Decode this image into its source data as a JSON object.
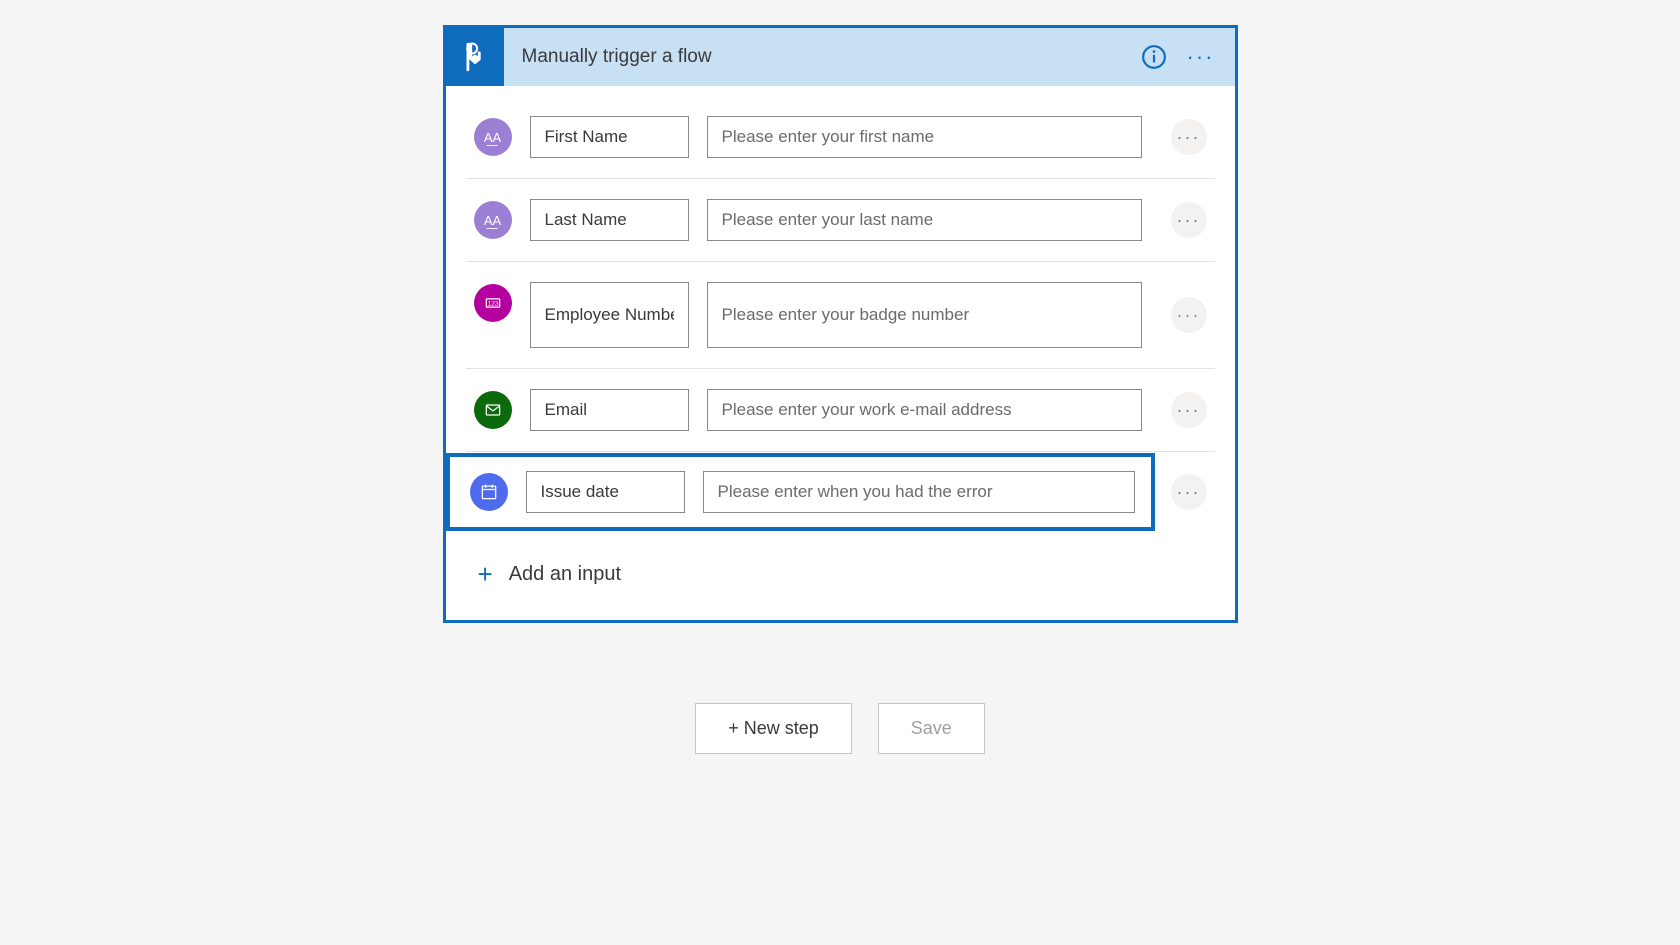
{
  "header": {
    "title": "Manually trigger a flow"
  },
  "inputs": [
    {
      "icon": "text",
      "iconColor": "purple",
      "label": "First Name",
      "placeholder": "Please enter your first name"
    },
    {
      "icon": "text",
      "iconColor": "purple",
      "label": "Last Name",
      "placeholder": "Please enter your last name"
    },
    {
      "icon": "number",
      "iconColor": "magenta",
      "label": "Employee Number",
      "placeholder": "Please enter your badge number"
    },
    {
      "icon": "email",
      "iconColor": "green",
      "label": "Email",
      "placeholder": "Please enter your work e-mail address"
    },
    {
      "icon": "date",
      "iconColor": "blue",
      "label": "Issue date",
      "placeholder": "Please enter when you had the error",
      "highlighted": true
    }
  ],
  "addInput": {
    "label": "Add an input"
  },
  "footer": {
    "newStep": "+ New step",
    "save": "Save"
  }
}
